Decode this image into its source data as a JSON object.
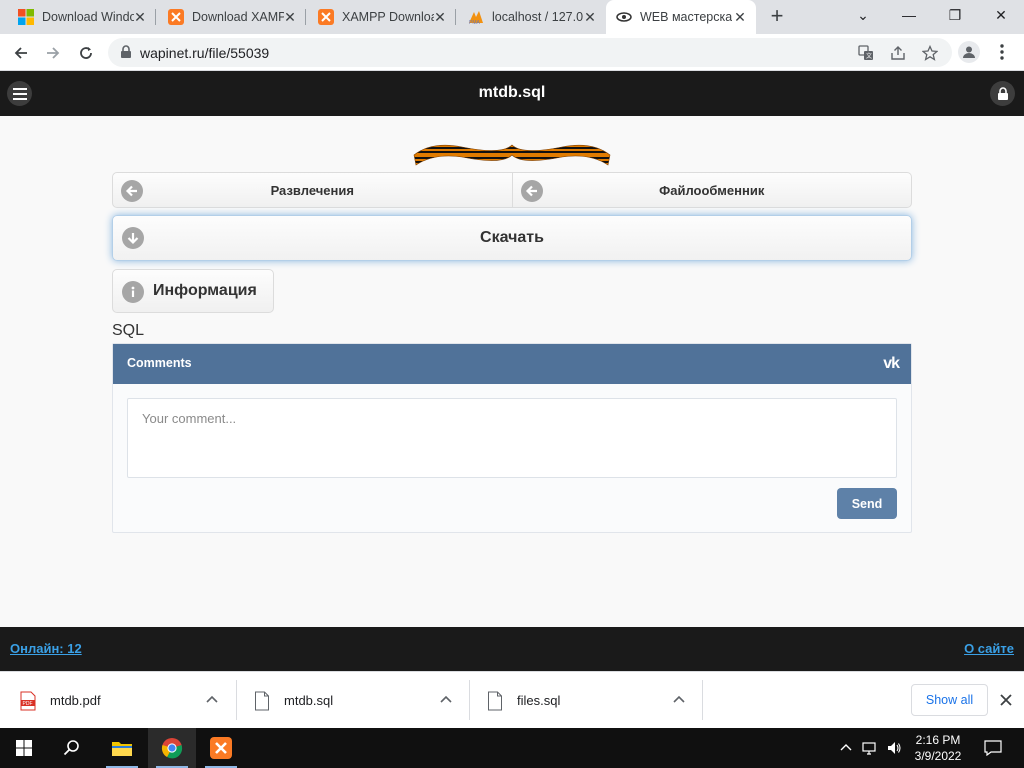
{
  "browser": {
    "tabs": [
      {
        "title": "Download Windo",
        "icon": "windows-icon"
      },
      {
        "title": "Download XAMP",
        "icon": "xampp-icon"
      },
      {
        "title": "XAMPP Downloa",
        "icon": "xampp-icon"
      },
      {
        "title": "localhost / 127.0",
        "icon": "phpmyadmin-icon"
      },
      {
        "title": "WEB мастерска",
        "icon": "wapinet-icon",
        "active": true
      }
    ],
    "url": "wapinet.ru/file/55039"
  },
  "site": {
    "title": "mtdb.sql",
    "nav": [
      {
        "label": "Развлечения",
        "icon": "arrow-left-icon"
      },
      {
        "label": "Файлообменник",
        "icon": "arrow-left-icon"
      }
    ],
    "download_label": "Скачать",
    "info_label": "Информация",
    "file_type": "SQL",
    "footer": {
      "online_label": "Онлайн: 12",
      "about_label": "О сайте"
    }
  },
  "comments": {
    "header": "Comments",
    "logo": "vk",
    "placeholder": "Your comment...",
    "send_label": "Send"
  },
  "downloads": {
    "items": [
      {
        "name": "mtdb.pdf",
        "type": "pdf"
      },
      {
        "name": "mtdb.sql",
        "type": "file"
      },
      {
        "name": "files.sql",
        "type": "file"
      }
    ],
    "show_all_label": "Show all"
  },
  "taskbar": {
    "time": "2:16 PM",
    "date": "3/9/2022"
  },
  "colors": {
    "header_bg": "#1a1a1a",
    "vk_blue": "#507299",
    "send_blue": "#5e81a8",
    "link_blue": "#3aa0e6"
  }
}
